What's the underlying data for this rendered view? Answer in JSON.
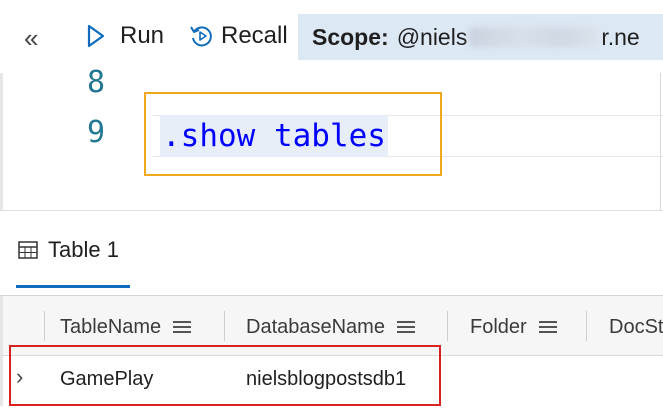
{
  "toolbar": {
    "collapse_glyph": "«",
    "run_label": "Run",
    "recall_label": "Recall",
    "scope_label": "Scope:",
    "scope_value_start": "@niels",
    "scope_value_end": "r.ne"
  },
  "editor": {
    "lines": [
      {
        "number": "8",
        "text": ""
      },
      {
        "number": "9",
        "text": ".show tables"
      }
    ]
  },
  "results": {
    "tab_label": "Table 1",
    "columns": [
      "TableName",
      "DatabaseName",
      "Folder",
      "DocSt"
    ],
    "rows": [
      {
        "expand_glyph": "›",
        "TableName": "GamePlay",
        "DatabaseName": "nielsblogpostsdb1"
      }
    ]
  },
  "colors": {
    "accent": "#0f6cbd",
    "keyword": "#0000ff",
    "line_number": "#237893",
    "highlight_orange": "#f0a81d",
    "highlight_red": "#d9221f",
    "scope_bg": "#dde8f5"
  }
}
